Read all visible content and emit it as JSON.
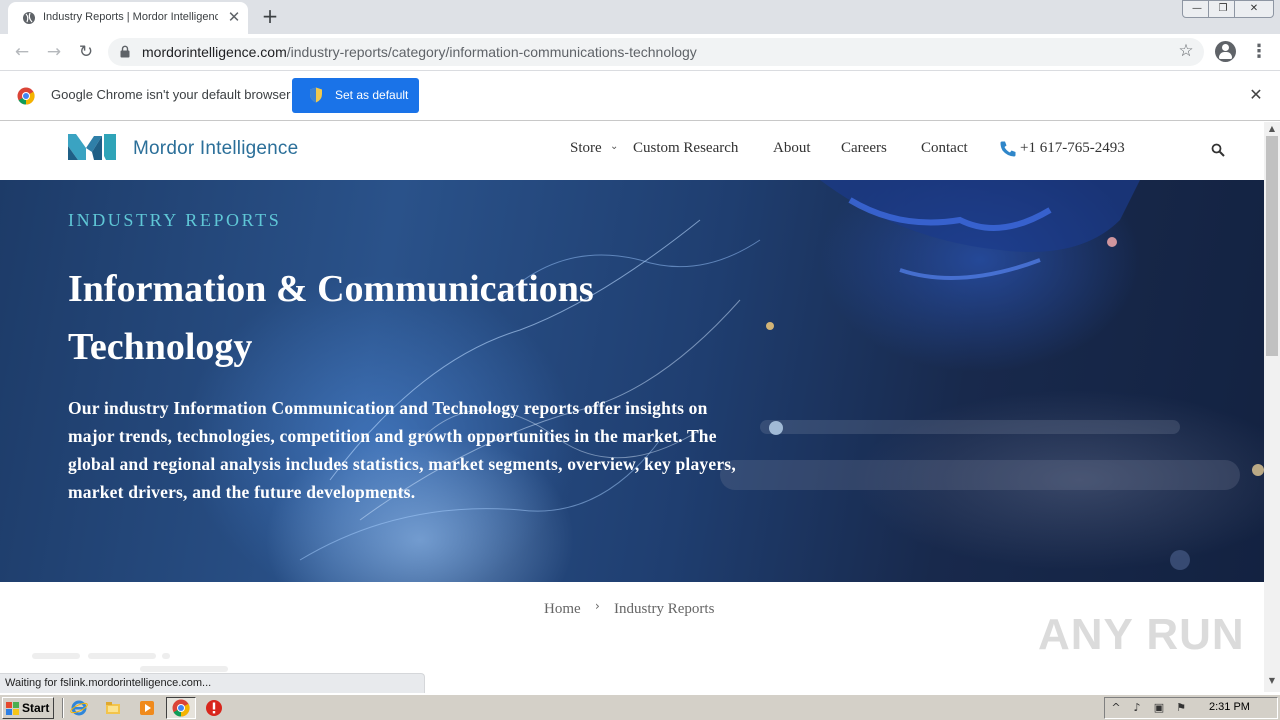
{
  "browser": {
    "tab": {
      "title": "Industry Reports | Mordor Intelligence",
      "close_glyph": "✕"
    },
    "new_tab_glyph": "+",
    "window_buttons": {
      "minimize": "—",
      "maximize": "❐",
      "close": "✕"
    },
    "nav": {
      "back": "←",
      "forward": "→",
      "reload": "↻"
    },
    "address": {
      "host": "mordorintelligence.com",
      "path": "/industry-reports/category/information-communications-technology"
    },
    "star_glyph": "☆",
    "menu_glyph": "⋮",
    "infobar": {
      "message": "Google Chrome isn't your default browser",
      "button_label": "Set as default",
      "close_glyph": "✕"
    },
    "status_text": "Waiting for fslink.mordorintelligence.com..."
  },
  "site": {
    "logo_text": "Mordor Intelligence",
    "nav": {
      "store": "Store",
      "store_caret": "⌄",
      "custom_research": "Custom Research",
      "about": "About",
      "careers": "Careers",
      "contact": "Contact",
      "phone": "+1 617-765-2493"
    },
    "hero": {
      "kicker": "INDUSTRY REPORTS",
      "title": "Information & Communications Technology",
      "description": "Our industry Information Communication and Technology reports offer insights on major trends, technologies, competition and growth opportunities in the market. The global and regional analysis includes statistics, market segments, overview, key players, market drivers, and the future developments."
    },
    "breadcrumb": {
      "home": "Home",
      "separator": "›",
      "current": "Industry Reports"
    }
  },
  "scrollbar": {
    "up": "▲",
    "down": "▼"
  },
  "watermark": "ANY RUN",
  "taskbar": {
    "start_label": "Start",
    "clock": "2:31 PM",
    "tray_glyphs": [
      "^",
      "♪",
      "▣",
      "⚑"
    ]
  },
  "colors": {
    "accent_blue": "#1a73e8",
    "logo_teal": "#2fa4b8",
    "logo_blue": "#2b6f99",
    "hero_kicker": "#5fc7d6"
  }
}
